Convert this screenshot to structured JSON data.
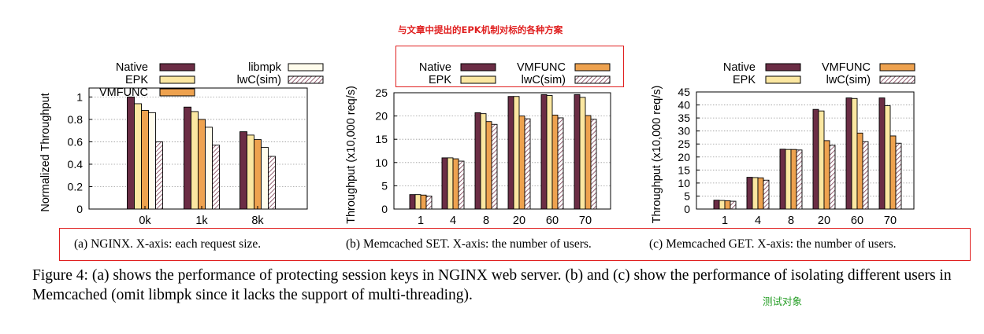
{
  "annotations": {
    "top": "与文章中提出的EPK机制对标的各种方案",
    "bottom": "测试对象",
    "box_color": "#e02020",
    "bottom_color": "#2aa02a"
  },
  "series_colors": {
    "Native": "#6b2d45",
    "EPK": "#fbe7a1",
    "VMFUNC": "#eea24f",
    "libmpk": "#fffcec",
    "lwC(sim)": "hatch"
  },
  "captions": {
    "a": "(a) NGINX. X-axis: each request size.",
    "b": "(b) Memcached SET. X-axis: the number of users.",
    "c": "(c) Memcached GET. X-axis: the number of users."
  },
  "figure_caption": "Figure 4: (a) shows the performance of protecting session keys in NGINX web server. (b) and (c) show the performance of isolating different users in Memcached (omit libmpk since it lacks the support of multi-threading).",
  "chart_data": [
    {
      "type": "bar",
      "ylabel": "Normalized Throughput",
      "xlabel": "",
      "ylim": [
        0,
        1.08
      ],
      "yticks": [
        "0",
        "0.2",
        "0.4",
        "0.6",
        "0.8",
        "1"
      ],
      "categories": [
        "0k",
        "1k",
        "8k"
      ],
      "legend_placement": "top",
      "series": [
        {
          "name": "Native",
          "values": [
            1.0,
            0.91,
            0.69
          ]
        },
        {
          "name": "EPK",
          "values": [
            0.94,
            0.87,
            0.66
          ]
        },
        {
          "name": "VMFUNC",
          "values": [
            0.88,
            0.8,
            0.62
          ]
        },
        {
          "name": "libmpk",
          "values": [
            0.86,
            0.73,
            0.55
          ]
        },
        {
          "name": "lwC(sim)",
          "values": [
            0.6,
            0.57,
            0.47
          ]
        }
      ]
    },
    {
      "type": "bar",
      "ylabel": "Throughput (x10,000 req/s)",
      "xlabel": "",
      "ylim": [
        0,
        25
      ],
      "yticks": [
        "0",
        "5",
        "10",
        "15",
        "20",
        "25"
      ],
      "categories": [
        "1",
        "4",
        "8",
        "20",
        "60",
        "70"
      ],
      "legend_placement": "top",
      "series": [
        {
          "name": "Native",
          "values": [
            3.1,
            11.0,
            20.7,
            24.2,
            24.6,
            24.6
          ]
        },
        {
          "name": "EPK",
          "values": [
            3.1,
            11.0,
            20.5,
            24.2,
            24.4,
            24.0
          ]
        },
        {
          "name": "VMFUNC",
          "values": [
            3.0,
            10.8,
            18.8,
            20.0,
            20.2,
            20.1
          ]
        },
        {
          "name": "lwC(sim)",
          "values": [
            2.8,
            10.3,
            18.2,
            19.4,
            19.6,
            19.3
          ]
        }
      ]
    },
    {
      "type": "bar",
      "ylabel": "Throughput (x10,000 req/s)",
      "xlabel": "",
      "ylim": [
        0,
        45
      ],
      "yticks": [
        "0",
        "5",
        "10",
        "15",
        "20",
        "25",
        "30",
        "35",
        "40",
        "45"
      ],
      "categories": [
        "1",
        "4",
        "8",
        "20",
        "60",
        "70"
      ],
      "legend_placement": "top",
      "series": [
        {
          "name": "Native",
          "values": [
            3.4,
            12.2,
            23.0,
            38.3,
            42.7,
            42.7
          ]
        },
        {
          "name": "EPK",
          "values": [
            3.3,
            12.1,
            22.9,
            37.7,
            42.5,
            39.7
          ]
        },
        {
          "name": "VMFUNC",
          "values": [
            3.2,
            12.0,
            22.9,
            26.3,
            29.2,
            28.1
          ]
        },
        {
          "name": "lwC(sim)",
          "values": [
            3.0,
            11.1,
            22.7,
            24.5,
            25.9,
            25.3
          ]
        }
      ]
    }
  ]
}
